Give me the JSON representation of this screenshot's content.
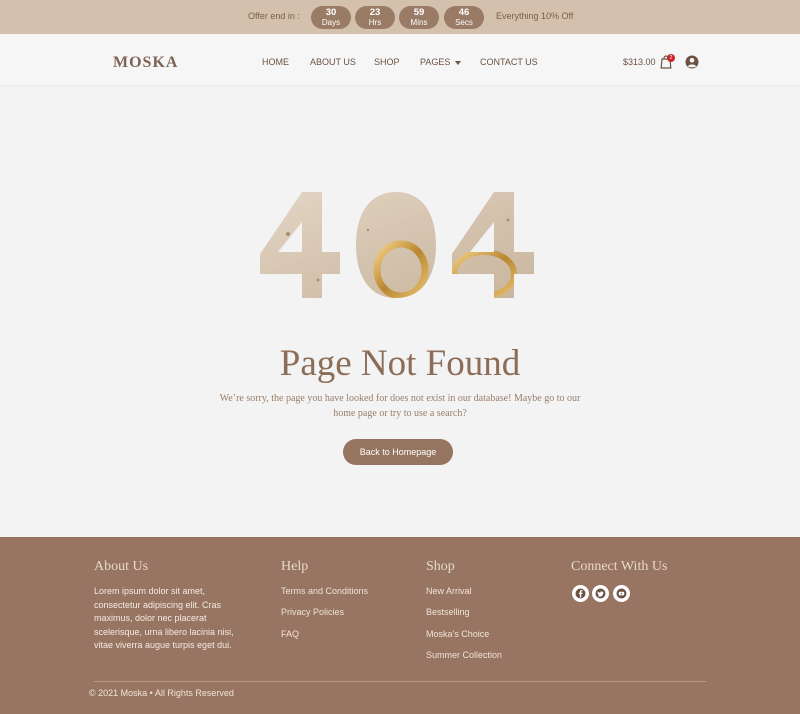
{
  "promo": {
    "offer_label": "Offer end in :",
    "timers": [
      {
        "value": "30",
        "unit": "Days"
      },
      {
        "value": "23",
        "unit": "Hrs"
      },
      {
        "value": "59",
        "unit": "Mins"
      },
      {
        "value": "46",
        "unit": "Secs"
      }
    ],
    "deal_text": "Everything 10% Off"
  },
  "header": {
    "logo": "MOSKA",
    "nav": [
      "HOME",
      "ABOUT US",
      "SHOP",
      "PAGES",
      "CONTACT US"
    ],
    "cart_total": "$313.00",
    "cart_count": "2"
  },
  "error": {
    "code": "404",
    "title": "Page Not Found",
    "message": "We’re sorry, the page you have looked for does not exist in our database! Maybe go to our home page or try to use a search?",
    "button": "Back to Homepage"
  },
  "footer": {
    "about": {
      "title": "About Us",
      "text": "Lorem ipsum dolor sit amet, consectetur adipiscing elit. Cras maximus, dolor nec placerat scelerisque, urna libero lacinia nisi, vitae viverra augue turpis eget dui."
    },
    "help": {
      "title": "Help",
      "links": [
        "Terms and Conditions",
        "Privacy Policies",
        "FAQ"
      ]
    },
    "shop": {
      "title": "Shop",
      "links": [
        "New Arrival",
        "Bestselling",
        "Moska's Choice",
        "Summer Collection"
      ]
    },
    "connect": {
      "title": "Connect With Us",
      "icons": [
        "facebook-icon",
        "twitter-icon",
        "youtube-icon"
      ]
    },
    "copyright": "© 2021 Moska • All Rights Reserved"
  },
  "colors": {
    "topbar": "#d3c1ad",
    "accent": "#957460",
    "footer": "#977562",
    "badge": "#c62828"
  }
}
